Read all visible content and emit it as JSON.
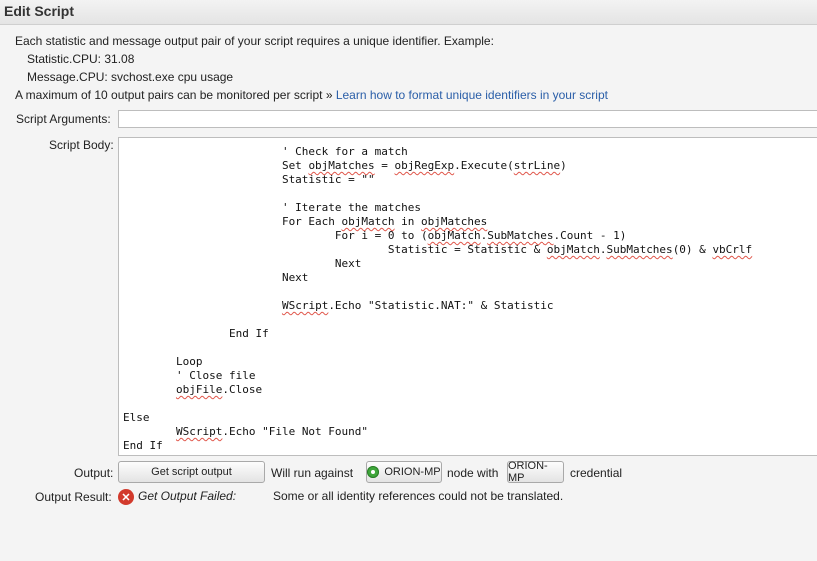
{
  "header": {
    "title": "Edit Script"
  },
  "intro": {
    "line1": "Each statistic and message output pair of your script requires a unique identifier. Example:",
    "line2": "Statistic.CPU: 31.08",
    "line3": "Message.CPU: svchost.exe cpu usage",
    "line4": "A maximum of 10 output pairs can be monitored per script » ",
    "link": "Learn how to format unique identifiers in your script"
  },
  "form": {
    "args_label": "Script Arguments:",
    "args_value": "",
    "body_label": "Script Body:",
    "output_label": "Output:",
    "result_label": "Output Result:"
  },
  "code": {
    "lines": [
      "                        ' Check for a match",
      "                        Set objMatches = objRegExp.Execute(strLine)",
      "                        Statistic = \"\"",
      "",
      "                        ' Iterate the matches",
      "                        For Each objMatch in objMatches",
      "                                For i = 0 to (objMatch.SubMatches.Count - 1)",
      "                                        Statistic = Statistic & objMatch.SubMatches(0) & vbCrlf",
      "                                Next",
      "                        Next",
      "",
      "                        WScript.Echo \"Statistic.NAT:\" & Statistic",
      "",
      "                End If",
      "",
      "        Loop",
      "        ' Close file",
      "        objFile.Close",
      "",
      "Else",
      "        WScript.Echo \"File Not Found\"",
      "End If"
    ],
    "squiggly_words": [
      "objMatches",
      "objRegExp",
      "strLine",
      "objMatch",
      "SubMatches",
      "vbCrlf",
      "WScript",
      "objFile"
    ]
  },
  "output": {
    "button_label": "Get script output",
    "will_run": "Will run against",
    "node_name": "ORION-MP",
    "node_with": "node with",
    "cred_name": "ORION-MP",
    "credential": "credential"
  },
  "result": {
    "status": "Get Output Failed:",
    "message": "Some or all identity references could not be translated."
  },
  "colors": {
    "link": "#2a5ea8",
    "ok": "#3ea63a",
    "error": "#d23a2c",
    "squiggle": "#e0564a"
  },
  "icons": {
    "node_status": "green-up-status-icon",
    "error": "red-x-circle-icon"
  }
}
